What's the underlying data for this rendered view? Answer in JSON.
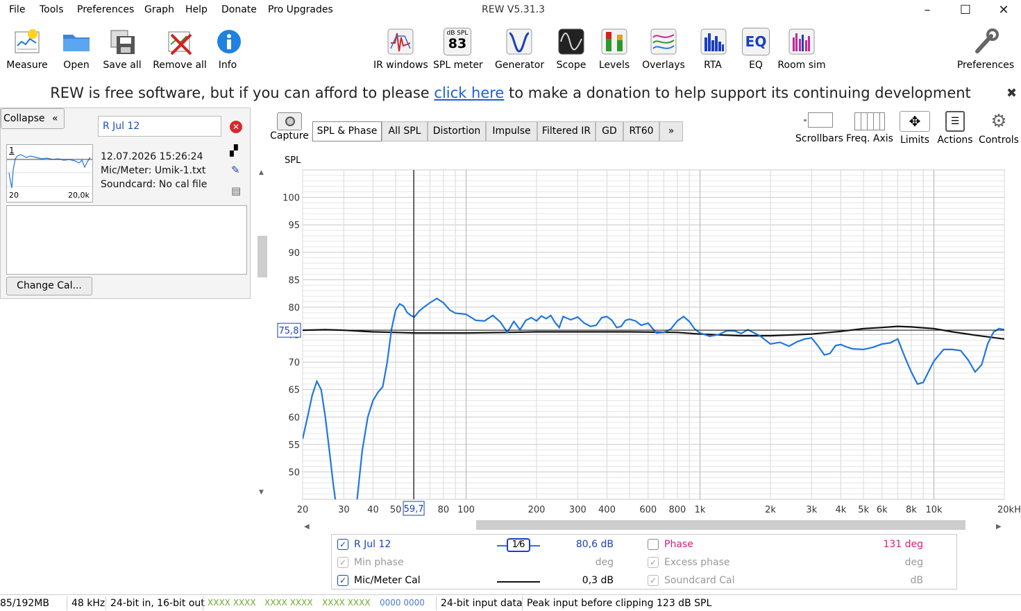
{
  "menu": [
    "File",
    "Tools",
    "Preferences",
    "Graph",
    "Help",
    "Donate",
    "Pro Upgrades"
  ],
  "app_title": "REW V5.31.3",
  "window_controls": {
    "minimize": "–",
    "maximize": "☐",
    "close": "✕"
  },
  "toolbar_left": [
    {
      "label": "Measure",
      "icon": "measure-icon"
    },
    {
      "label": "Open",
      "icon": "folder-icon"
    },
    {
      "label": "Save all",
      "icon": "save-icon"
    },
    {
      "label": "Remove all",
      "icon": "remove-icon"
    },
    {
      "label": "Info",
      "icon": "info-icon"
    }
  ],
  "toolbar_center": [
    {
      "label": "IR windows",
      "icon": "ir-windows-icon"
    },
    {
      "label": "SPL meter",
      "icon": "spl-meter-icon",
      "badge_top": "dB SPL",
      "badge_value": "83"
    },
    {
      "label": "Generator",
      "icon": "generator-icon"
    },
    {
      "label": "Scope",
      "icon": "scope-icon"
    },
    {
      "label": "Levels",
      "icon": "levels-icon"
    },
    {
      "label": "Overlays",
      "icon": "overlays-icon"
    },
    {
      "label": "RTA",
      "icon": "rta-icon"
    },
    {
      "label": "EQ",
      "icon": "eq-icon",
      "badge_value": "EQ"
    },
    {
      "label": "Room sim",
      "icon": "room-sim-icon"
    }
  ],
  "toolbar_right": {
    "label": "Preferences",
    "icon": "wrench-icon"
  },
  "banner": {
    "before": "REW is free software, but if you can afford to please ",
    "link": "click here",
    "after": " to make a donation to help support its continuing development",
    "close": "✖"
  },
  "left_panel": {
    "collapse_label": "Collapse",
    "collapse_icon": "«",
    "measurement_name": "R Jul 12",
    "thumb_index": "1",
    "thumb_x_min": "20",
    "thumb_x_max": "20,0k",
    "date": "12.07.2026 15:26:24",
    "mic": "Mic/Meter: Umik-1.txt",
    "soundcard": "Soundcard: No cal file",
    "change_cal": "Change Cal..."
  },
  "capture_label": "Capture",
  "graph_tabs": [
    "SPL & Phase",
    "All SPL",
    "Distortion",
    "Impulse",
    "Filtered IR",
    "GD",
    "RT60",
    "»"
  ],
  "active_tab": "SPL & Phase",
  "graph_controls": [
    "Scrollbars",
    "Freq. Axis",
    "Limits",
    "Actions",
    "Controls"
  ],
  "chart_data": {
    "type": "line",
    "ylabel": "SPL",
    "xscale": "log",
    "xlim": [
      20,
      20000
    ],
    "ylim": [
      45,
      105
    ],
    "y_ticks": [
      50,
      55,
      60,
      65,
      70,
      75,
      80,
      85,
      90,
      95,
      100
    ],
    "x_tick_labels": [
      {
        "f": 20,
        "t": "20"
      },
      {
        "f": 30,
        "t": "30"
      },
      {
        "f": 40,
        "t": "40"
      },
      {
        "f": 50,
        "t": "50"
      },
      {
        "f": 80,
        "t": "80"
      },
      {
        "f": 100,
        "t": "100"
      },
      {
        "f": 200,
        "t": "200"
      },
      {
        "f": 300,
        "t": "300"
      },
      {
        "f": 400,
        "t": "400"
      },
      {
        "f": 600,
        "t": "600"
      },
      {
        "f": 800,
        "t": "800"
      },
      {
        "f": 1000,
        "t": "1k"
      },
      {
        "f": 2000,
        "t": "2k"
      },
      {
        "f": 3000,
        "t": "3k"
      },
      {
        "f": 4000,
        "t": "4k"
      },
      {
        "f": 5000,
        "t": "5k"
      },
      {
        "f": 6000,
        "t": "6k"
      },
      {
        "f": 8000,
        "t": "8k"
      },
      {
        "f": 10000,
        "t": "10k"
      },
      {
        "f": 20000,
        "t": "20kHz"
      }
    ],
    "cursor": {
      "x": 59.7,
      "x_label": "59,7",
      "y": 75.8,
      "y_label": "75,8"
    },
    "series": [
      {
        "name": "R Jul 12",
        "color": "#1f77e0",
        "x": [
          20,
          21,
          22,
          23,
          24,
          25,
          26,
          27,
          28,
          29,
          30,
          32,
          34,
          36,
          38,
          40,
          42,
          44,
          46,
          48,
          50,
          52,
          54,
          56,
          58,
          60,
          63,
          66,
          70,
          75,
          80,
          85,
          90,
          95,
          100,
          110,
          120,
          130,
          140,
          150,
          160,
          170,
          180,
          190,
          200,
          210,
          220,
          230,
          240,
          250,
          260,
          280,
          300,
          320,
          340,
          360,
          380,
          400,
          420,
          440,
          460,
          480,
          500,
          530,
          560,
          600,
          650,
          700,
          750,
          800,
          850,
          900,
          950,
          1000,
          1100,
          1200,
          1300,
          1400,
          1500,
          1600,
          1800,
          2000,
          2200,
          2400,
          2600,
          2800,
          3000,
          3200,
          3400,
          3600,
          3800,
          4000,
          4200,
          4500,
          5000,
          5500,
          6000,
          6500,
          7000,
          7500,
          8000,
          8500,
          9000,
          9500,
          10000,
          11000,
          12000,
          13000,
          14000,
          15000,
          16000,
          17000,
          18000,
          19000,
          20000
        ],
        "y": [
          56,
          60,
          64,
          66.5,
          65,
          60,
          54,
          48,
          43,
          38,
          32,
          35,
          44,
          54,
          60,
          63,
          64.5,
          65.5,
          70,
          76,
          79.5,
          80.6,
          80.2,
          79,
          78.5,
          78.2,
          79.3,
          80,
          80.8,
          81.6,
          80.8,
          79.5,
          78.9,
          78.8,
          78.7,
          77.6,
          77.5,
          78.5,
          77.3,
          75.4,
          77.4,
          75.9,
          77.6,
          78.1,
          77.5,
          78.4,
          77.9,
          78.5,
          77.2,
          76.3,
          78.3,
          77.7,
          78.2,
          77.1,
          76.5,
          76.7,
          78.1,
          78.3,
          77.6,
          76.3,
          76.5,
          77.6,
          77.8,
          77.5,
          76.7,
          77.1,
          75.3,
          75.4,
          76,
          77.5,
          78.3,
          77.4,
          76,
          75.3,
          74.7,
          75,
          75.7,
          75.7,
          75.2,
          75.9,
          74.8,
          73.3,
          73.6,
          72.9,
          73.7,
          74.2,
          74.4,
          72.9,
          71.3,
          71.6,
          73,
          73.2,
          72.8,
          72.4,
          72.3,
          72.7,
          73.3,
          73.5,
          74.2,
          71,
          68.2,
          66,
          66.3,
          68.3,
          70.2,
          72.3,
          72.3,
          72.1,
          70.4,
          68.2,
          69.5,
          73.4,
          75.5,
          76.1,
          75.9
        ]
      },
      {
        "name": "Mic/Meter Cal",
        "color": "#111111",
        "x": [
          20,
          25,
          30,
          40,
          50,
          60,
          80,
          100,
          150,
          200,
          300,
          500,
          800,
          1000,
          1500,
          2000,
          3000,
          4000,
          5000,
          6000,
          7000,
          8000,
          10000,
          12000,
          15000,
          20000
        ],
        "y": [
          75.8,
          75.9,
          75.8,
          75.5,
          75.4,
          75.3,
          75.3,
          75.3,
          75.4,
          75.5,
          75.5,
          75.5,
          75.4,
          75.1,
          74.8,
          74.8,
          75.1,
          75.6,
          76.1,
          76.3,
          76.5,
          76.4,
          76.1,
          75.5,
          74.9,
          74.2
        ]
      }
    ]
  },
  "legend": {
    "rows": [
      {
        "checked": "✓",
        "name": "R Jul 12",
        "smoothing": "1⁄6",
        "value": "80,6 dB",
        "right_checked": "",
        "right_name": "Phase",
        "right_value": "131 deg"
      },
      {
        "checked": "✓",
        "name": "Min phase",
        "value": "deg",
        "right_checked": "✓",
        "right_name": "Excess phase",
        "right_value": "deg"
      },
      {
        "checked": "✓",
        "name": "Mic/Meter Cal",
        "value": "0,3 dB",
        "right_checked": "✓",
        "right_name": "Soundcard Cal",
        "right_value": "dB"
      }
    ]
  },
  "status": {
    "memory": "85/192MB",
    "rate": "48 kHz",
    "bits": "24-bit in, 16-bit out",
    "inputs": [
      "XXXX XXXX",
      "XXXX XXXX",
      "XXXX XXXX"
    ],
    "zeros": "0000 0000",
    "input_data": "24-bit input data",
    "peak": "Peak input before clipping 123 dB SPL"
  }
}
